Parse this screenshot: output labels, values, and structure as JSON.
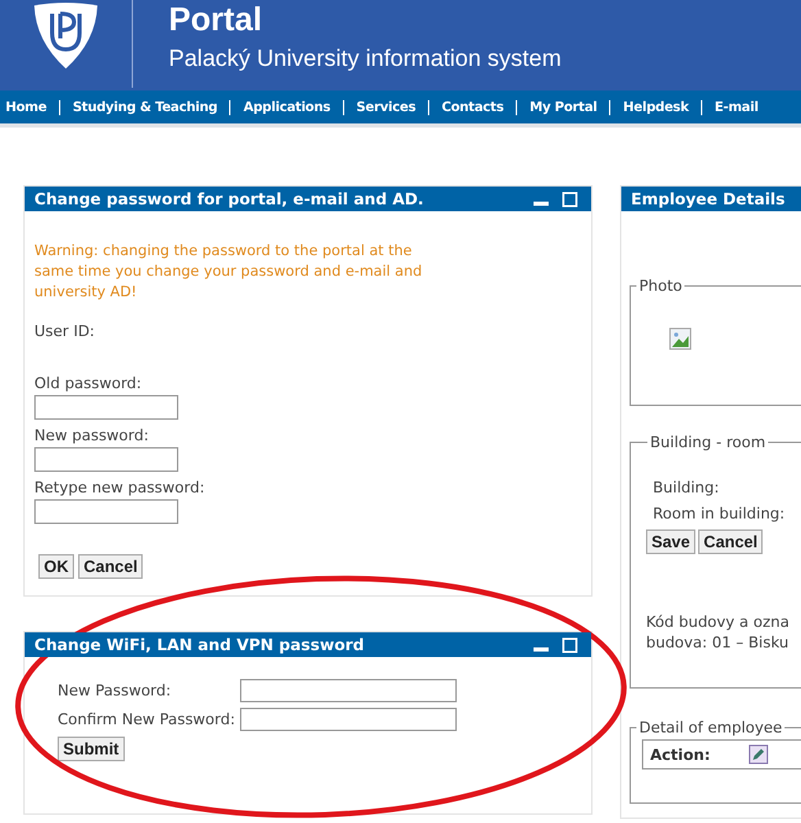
{
  "header": {
    "title": "Portal",
    "subtitle": "Palacký University information system"
  },
  "nav": [
    "Home",
    "Studying & Teaching",
    "Applications",
    "Services",
    "Contacts",
    "My Portal",
    "Helpdesk",
    "E-mail"
  ],
  "password_panel": {
    "title": "Change password for portal, e-mail and AD.",
    "warning": "Warning: changing the password to the portal at the same time you change your password and e-mail and university AD!",
    "user_id_label": "User ID:",
    "fields": [
      {
        "label": "Old password:"
      },
      {
        "label": "New password:"
      },
      {
        "label": "Retype new password:"
      }
    ],
    "buttons": [
      "OK",
      "Cancel"
    ]
  },
  "wifi_panel": {
    "title": "Change WiFi, LAN and VPN password",
    "fields": [
      {
        "label": "New Password:"
      },
      {
        "label": "Confirm New Password:"
      }
    ],
    "button": "Submit"
  },
  "employee_panel": {
    "title": "Employee Details",
    "photo_legend": "Photo",
    "building_legend": "Building - room",
    "building_label": "Building:",
    "room_label": "Room in building:",
    "buttons": [
      "Save",
      "Cancel"
    ],
    "note_lines": [
      "Kód budovy a ozna",
      "budova: 01 – Bisku"
    ],
    "detail_legend": "Detail of employee",
    "action_label": "Action:"
  }
}
